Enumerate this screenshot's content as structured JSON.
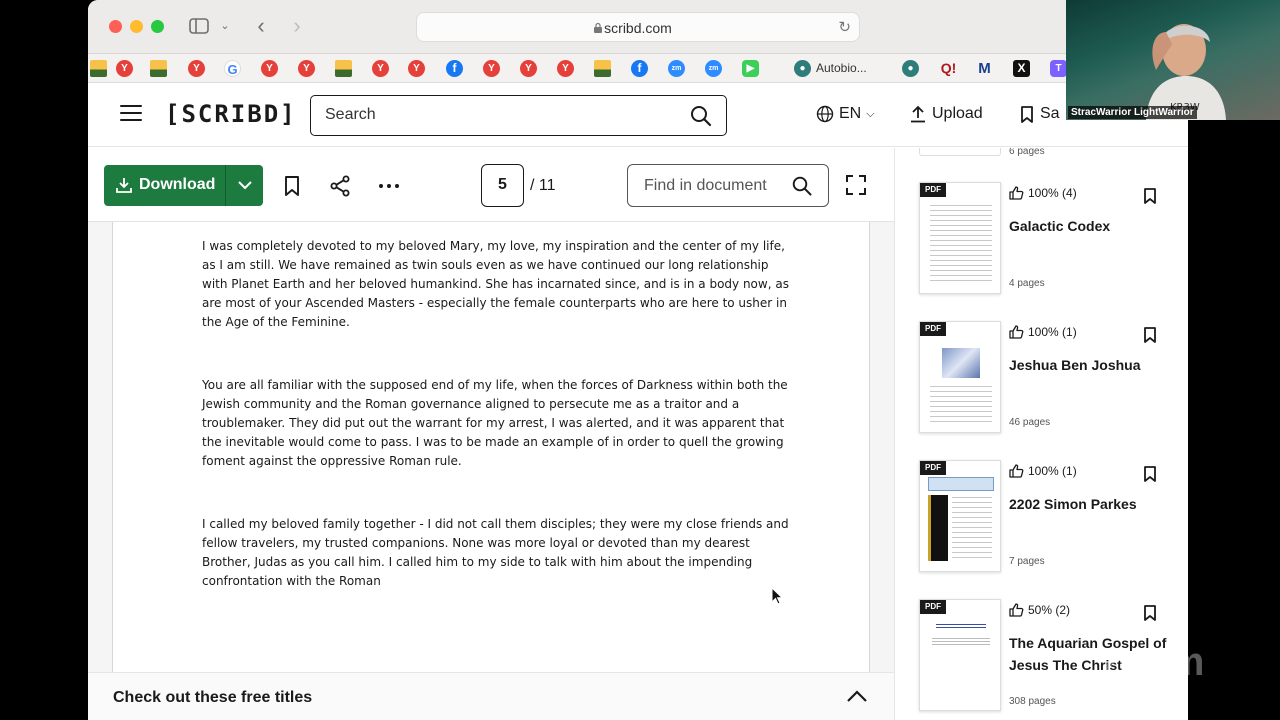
{
  "browser": {
    "url": "scribd.com",
    "bookmarks_tab_label": "Autobio..."
  },
  "header": {
    "logo": "[SCRIBD]",
    "search_placeholder": "Search",
    "language": "EN",
    "upload_label": "Upload",
    "save_label": "Sa"
  },
  "toolbar": {
    "download_label": "Download",
    "current_page": "5",
    "total_pages": "/ 11",
    "find_placeholder": "Find in document"
  },
  "document": {
    "paragraphs": [
      "I was completely devoted to my beloved Mary, my love, my inspiration and the center of my life, as I am still. We have remained as twin souls even as we have continued our long relationship with Planet Earth and her beloved humankind. She has incarnated since, and is in a body now, as are most of your Ascended Masters - especially the female counterparts who are here to usher in the Age of the Feminine.",
      "You are all familiar with the supposed end of my life, when the forces of Darkness within both the Jewish community and the Roman governance aligned to persecute me as a traitor and a troublemaker. They did put out the warrant for my arrest, I was alerted, and it was apparent that the inevitable would come to pass. I was to be made an example of in order to quell the growing foment against the oppressive Roman rule.",
      "I called my beloved family together - I did not call them disciples; they were my close friends and fellow travelers, my trusted companions. None was more loyal or devoted than my dearest Brother, Judas as you call him. I called him to my side to talk with him about the impending confrontation with the Roman"
    ],
    "free_titles_label": "Check out these free titles"
  },
  "related": {
    "prev_pages": "6 pages",
    "pdf_badge": "PDF",
    "cards": [
      {
        "rating": "100% (4)",
        "title": "Galactic Codex",
        "pages": "4 pages"
      },
      {
        "rating": "100% (1)",
        "title": "Jeshua Ben Joshua",
        "pages": "46 pages"
      },
      {
        "rating": "100% (1)",
        "title": "2202 Simon Parkes",
        "pages": "7 pages"
      },
      {
        "rating": "50% (2)",
        "title": "The Aquarian Gospel of Jesus The Christ",
        "pages": "308 pages"
      }
    ]
  },
  "webcam": {
    "participant_name": "StracWarrior LightWarrior",
    "watermark": "zoom"
  },
  "colors": {
    "download_green": "#1e7b40",
    "text": "#1a1a1a"
  }
}
